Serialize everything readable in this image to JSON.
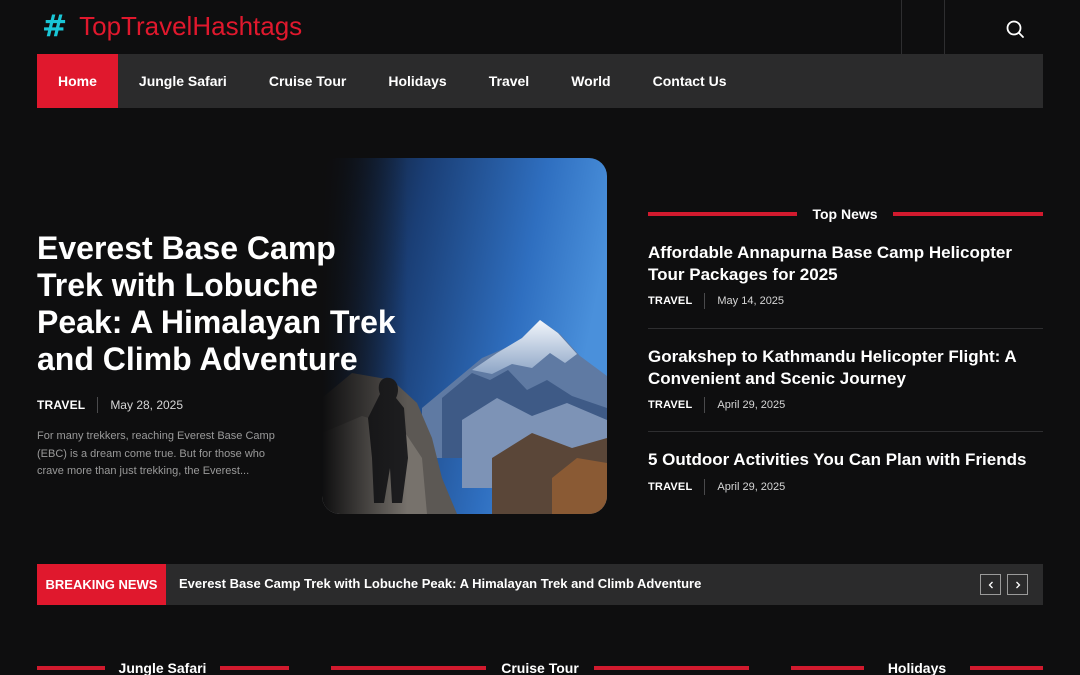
{
  "brand": {
    "hash": "#",
    "name": "TopTravelHashtags"
  },
  "colors": {
    "accent": "#e0182d",
    "hash": "#19c6d6",
    "nav_bg": "#2b2b2c",
    "page_bg": "#0e0e0f"
  },
  "header": {
    "search_icon": "search-icon"
  },
  "nav": {
    "items": [
      {
        "label": "Home",
        "active": true
      },
      {
        "label": "Jungle Safari"
      },
      {
        "label": "Cruise Tour"
      },
      {
        "label": "Holidays"
      },
      {
        "label": "Travel"
      },
      {
        "label": "World"
      },
      {
        "label": "Contact Us"
      }
    ]
  },
  "hero": {
    "title": "Everest Base Camp Trek with Lobuche Peak: A Himalayan Trek and Climb Adventure",
    "category": "TRAVEL",
    "date": "May 28, 2025",
    "excerpt": "For many trekkers, reaching Everest Base Camp (EBC) is a dream come true. But for those who crave more than just trekking, the Everest..."
  },
  "top_news": {
    "heading": "Top News",
    "items": [
      {
        "title": "Affordable Annapurna Base Camp Helicopter Tour Packages for 2025",
        "category": "TRAVEL",
        "date": "May 14, 2025"
      },
      {
        "title": "Gorakshep to Kathmandu Helicopter Flight: A Convenient and Scenic Journey",
        "category": "TRAVEL",
        "date": "April 29, 2025"
      },
      {
        "title": "5 Outdoor Activities You Can Plan with Friends",
        "category": "TRAVEL",
        "date": "April 29, 2025"
      }
    ]
  },
  "breaking": {
    "label": "BREAKING NEWS",
    "text": "Everest Base Camp Trek with Lobuche Peak: A Himalayan Trek and Climb Adventure",
    "prev_icon": "chevron-left-icon",
    "next_icon": "chevron-right-icon"
  },
  "sections": [
    {
      "label": "Jungle Safari"
    },
    {
      "label": "Cruise Tour"
    },
    {
      "label": "Holidays"
    }
  ]
}
